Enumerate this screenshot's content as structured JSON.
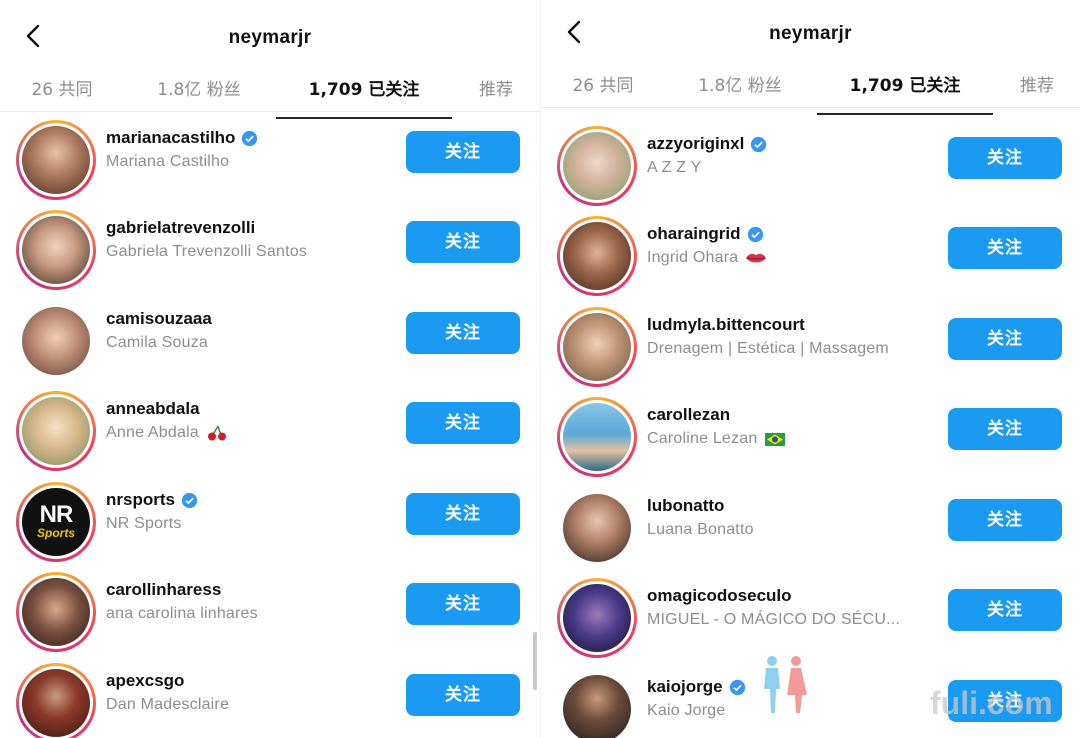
{
  "left": {
    "title": "neymarjr",
    "tabs": [
      {
        "label": "26 共同"
      },
      {
        "label": "1.8亿 粉丝"
      },
      {
        "label": "1,709 已关注"
      },
      {
        "label": "推荐"
      }
    ],
    "rows": [
      {
        "username": "marianacastilho",
        "fullname": "Mariana Castilho",
        "verified": true,
        "button": "关注"
      },
      {
        "username": "gabrielatrevenzolli",
        "fullname": "Gabriela Trevenzolli Santos",
        "verified": false,
        "button": "关注"
      },
      {
        "username": "camisouzaaa",
        "fullname": "Camila Souza",
        "verified": false,
        "button": "关注"
      },
      {
        "username": "anneabdala",
        "fullname": "Anne Abdala",
        "verified": false,
        "emoji": "cherry-emoji",
        "button": "关注"
      },
      {
        "username": "nrsports",
        "fullname": "NR Sports",
        "verified": true,
        "avatar_text": "NR",
        "avatar_subtext": "Sports",
        "button": "关注"
      },
      {
        "username": "carollinharess",
        "fullname": "ana carolina linhares",
        "verified": false,
        "button": "关注"
      },
      {
        "username": "apexcsgo",
        "fullname": "Dan Madesclaire",
        "verified": false,
        "button": "关注"
      }
    ]
  },
  "right": {
    "title": "neymarjr",
    "tabs": [
      {
        "label": "26 共同"
      },
      {
        "label": "1.8亿 粉丝"
      },
      {
        "label": "1,709 已关注"
      },
      {
        "label": "推荐"
      }
    ],
    "rows": [
      {
        "username": "azzyoriginxl",
        "fullname": "A Z Z Y",
        "verified": true,
        "button": "关注"
      },
      {
        "username": "oharaingrid",
        "fullname": "Ingrid Ohara",
        "verified": true,
        "emoji": "lips-emoji",
        "button": "关注"
      },
      {
        "username": "ludmyla.bittencourt",
        "fullname": "Drenagem | Estética | Massagem",
        "verified": false,
        "button": "关注"
      },
      {
        "username": "carollezan",
        "fullname": "Caroline Lezan",
        "verified": false,
        "emoji": "brazil-flag-emoji",
        "button": "关注"
      },
      {
        "username": "lubonatto",
        "fullname": "Luana Bonatto",
        "verified": false,
        "button": "关注"
      },
      {
        "username": "omagicodoseculo",
        "fullname": "MIGUEL - O MÁGICO DO SÉCU...",
        "verified": false,
        "button": "关注"
      },
      {
        "username": "kaiojorge",
        "fullname": "Kaio Jorge",
        "verified": true,
        "button": "关注"
      }
    ]
  },
  "watermark": {
    "text": "fuli.com"
  },
  "colors": {
    "accent": "#1a9af1",
    "verified": "#3897f0",
    "ring_start": "#f9b233",
    "ring_mid": "#ee3a5e",
    "ring_end": "#c13584"
  }
}
